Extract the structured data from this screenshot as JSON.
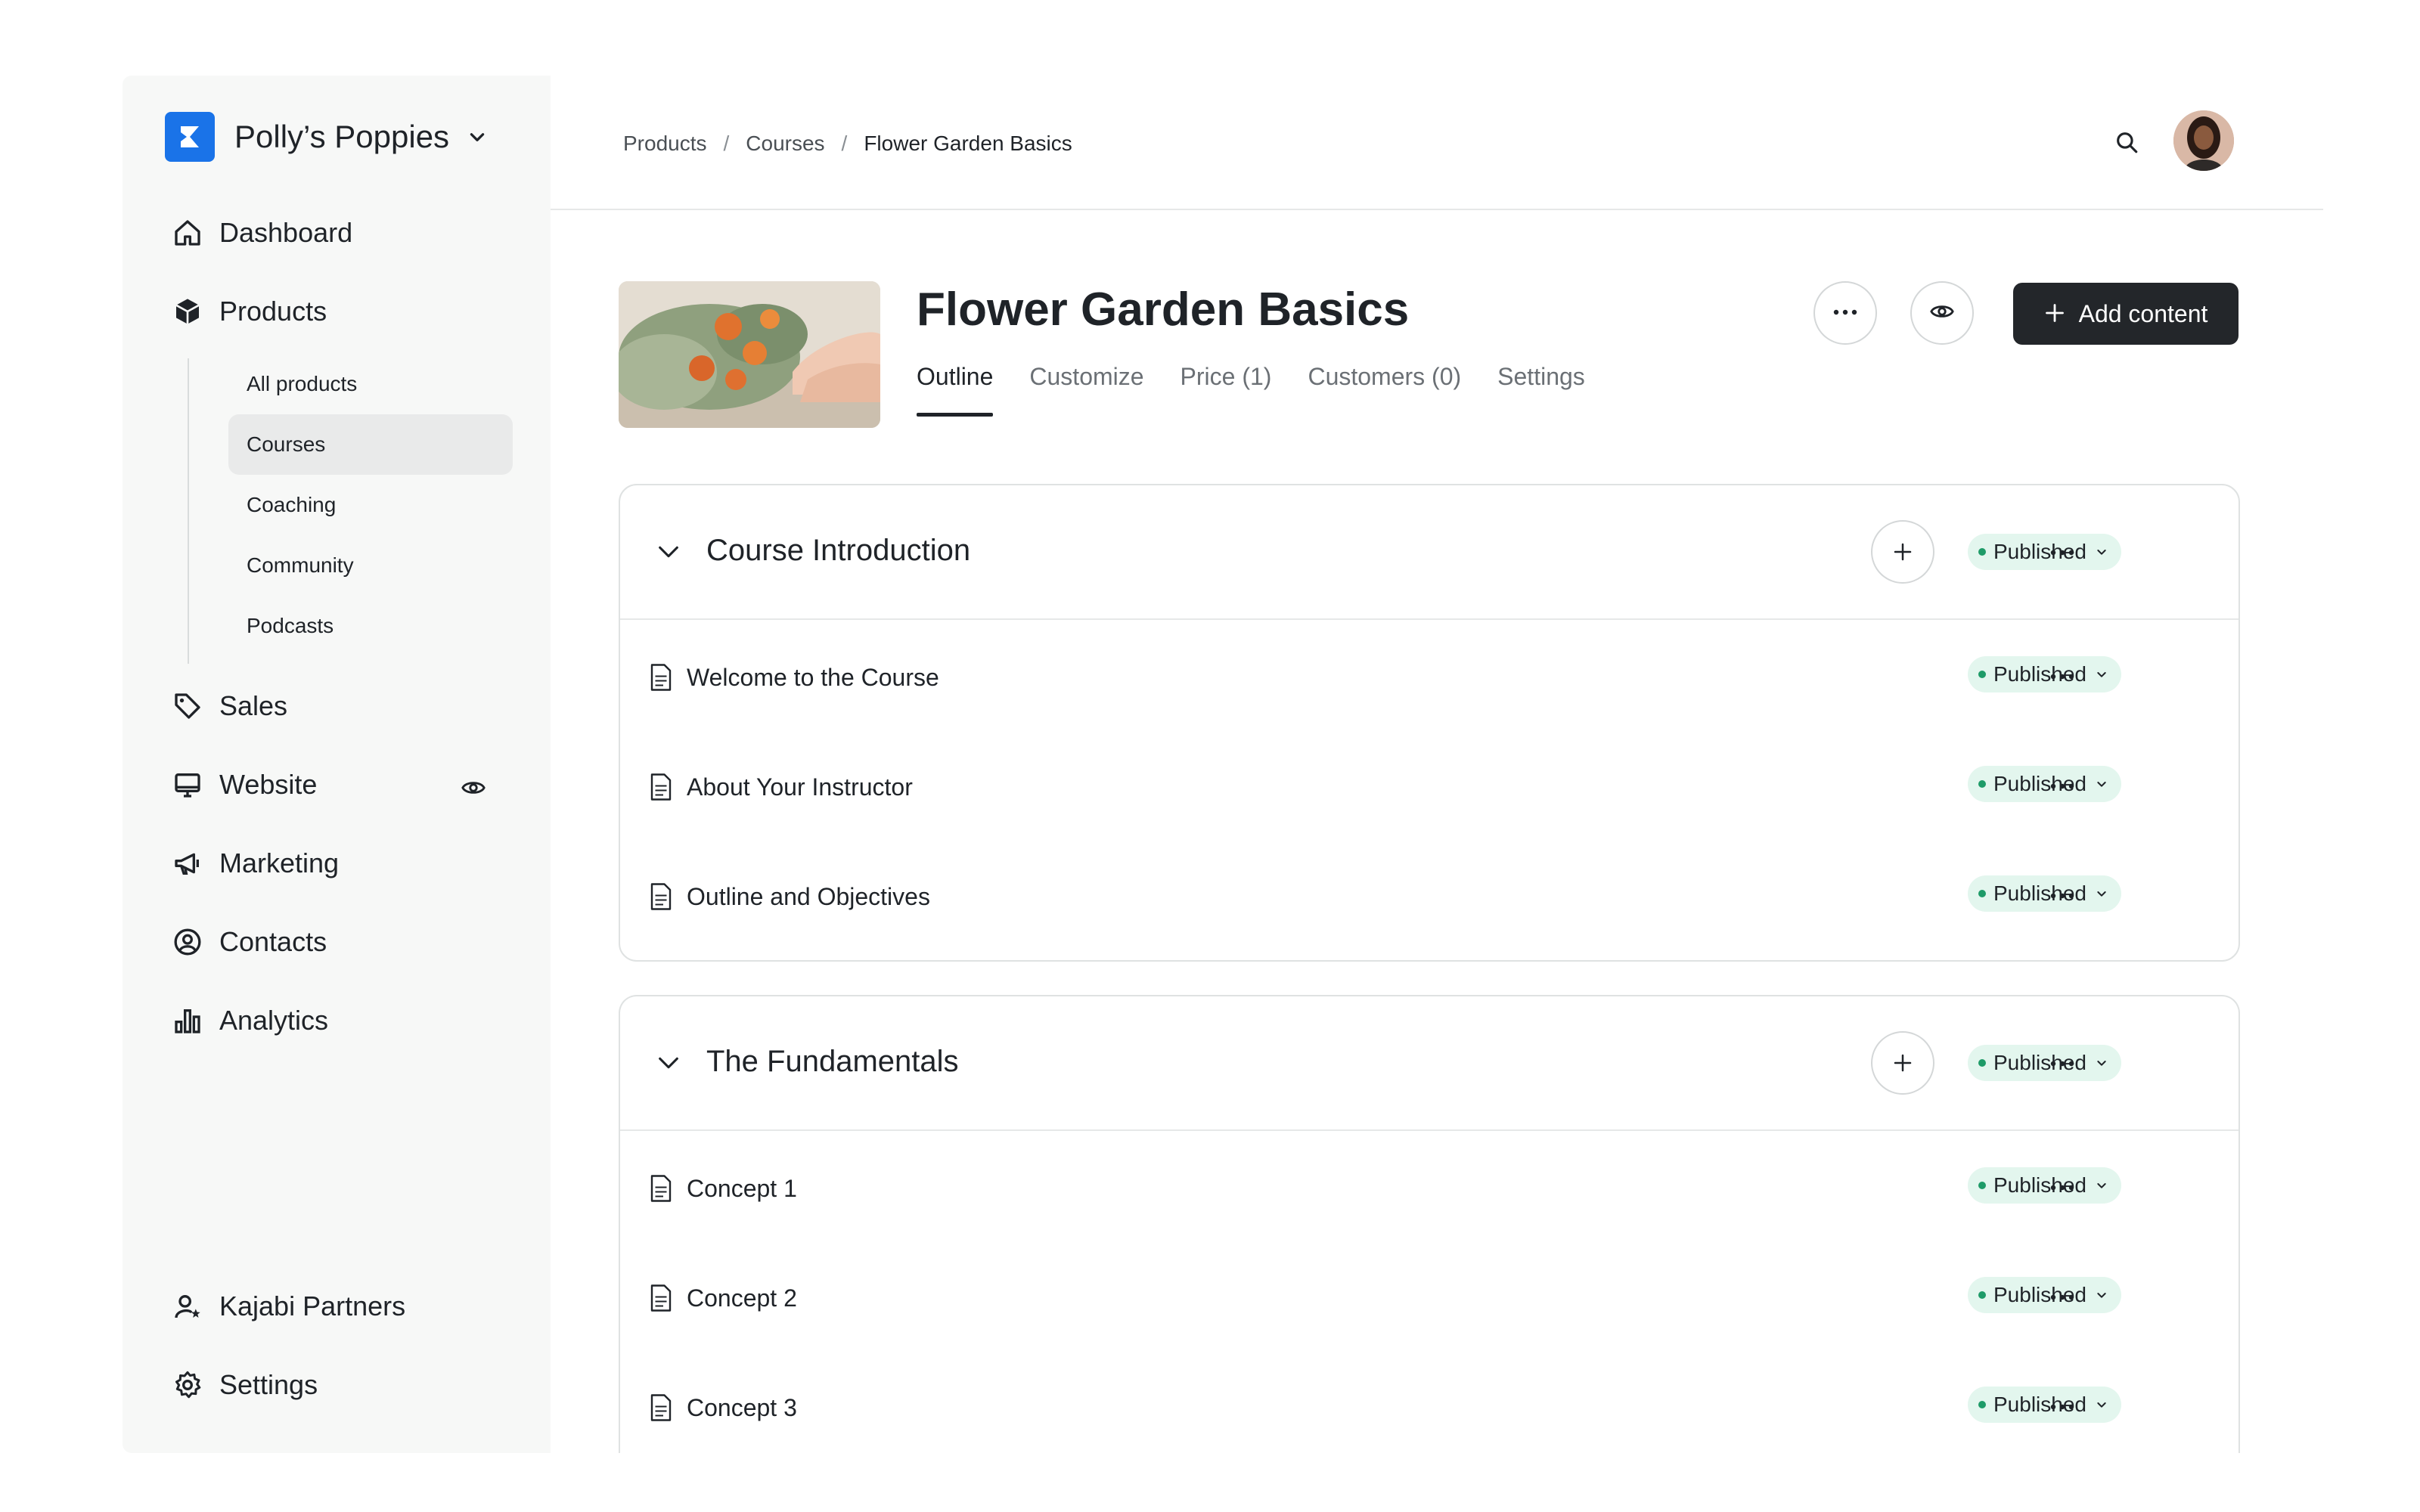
{
  "brand": {
    "name": "Polly’s Poppies"
  },
  "sidebar": {
    "nav": [
      {
        "label": "Dashboard",
        "icon": "home-icon"
      },
      {
        "label": "Products",
        "icon": "box-icon"
      },
      {
        "label": "Sales",
        "icon": "tag-icon"
      },
      {
        "label": "Website",
        "icon": "monitor-icon"
      },
      {
        "label": "Marketing",
        "icon": "megaphone-icon"
      },
      {
        "label": "Contacts",
        "icon": "contact-icon"
      },
      {
        "label": "Analytics",
        "icon": "bar-chart-icon"
      }
    ],
    "sub": [
      {
        "label": "All products"
      },
      {
        "label": "Courses",
        "active": true
      },
      {
        "label": "Coaching"
      },
      {
        "label": "Community"
      },
      {
        "label": "Podcasts"
      }
    ],
    "bottom": [
      {
        "label": "Kajabi Partners",
        "icon": "partner-icon"
      },
      {
        "label": "Settings",
        "icon": "gear-icon"
      }
    ]
  },
  "breadcrumb": {
    "items": [
      "Products",
      "Courses",
      "Flower Garden Basics"
    ],
    "separator": "/"
  },
  "page": {
    "title": "Flower Garden Basics",
    "tabs": [
      "Outline",
      "Customize",
      "Price (1)",
      "Customers (0)",
      "Settings"
    ],
    "active_tab": "Outline",
    "add_content_label": "Add content"
  },
  "sections": [
    {
      "title": "Course Introduction",
      "status": "Published",
      "lessons": [
        {
          "title": "Welcome to the Course",
          "status": "Published"
        },
        {
          "title": "About Your Instructor",
          "status": "Published"
        },
        {
          "title": "Outline and Objectives",
          "status": "Published"
        }
      ]
    },
    {
      "title": "The Fundamentals",
      "status": "Published",
      "lessons": [
        {
          "title": "Concept 1",
          "status": "Published"
        },
        {
          "title": "Concept 2",
          "status": "Published"
        },
        {
          "title": "Concept 3",
          "status": "Published"
        }
      ]
    }
  ],
  "colors": {
    "brand": "#1a73e8",
    "published_bg": "#e3f6ee",
    "published_dot": "#1e9b68",
    "primary_button": "#23262a"
  }
}
